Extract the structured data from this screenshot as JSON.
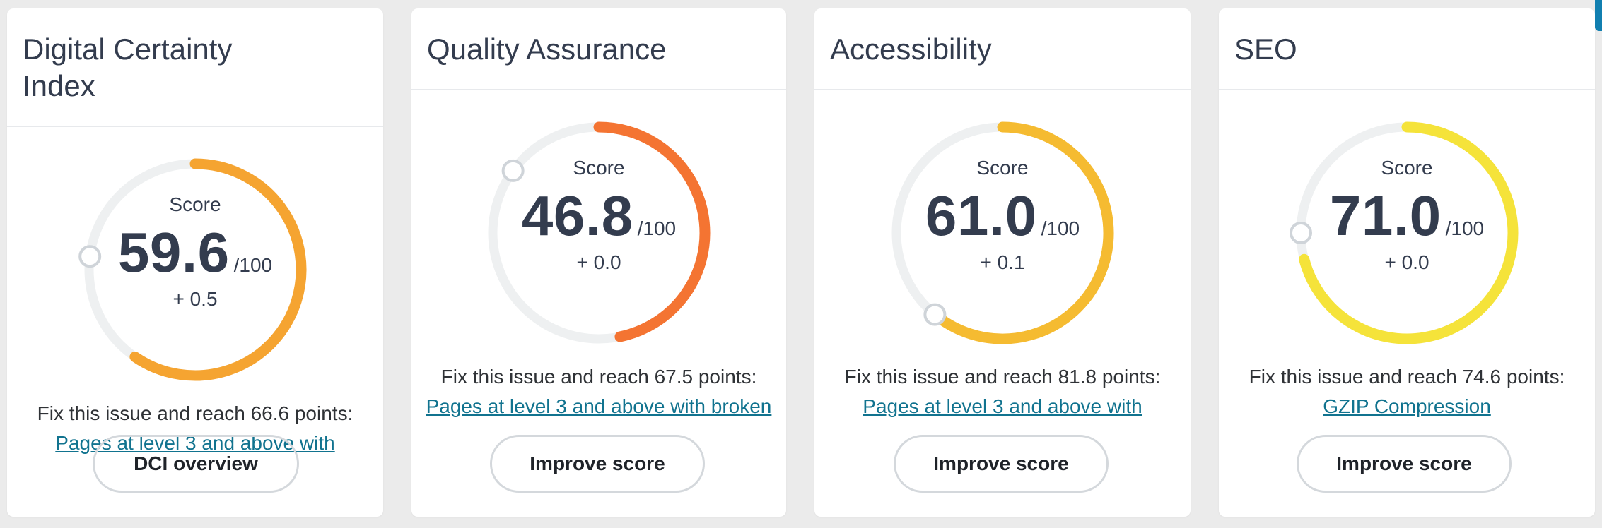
{
  "cards": [
    {
      "title": "Digital Certainty Index",
      "score_label": "Score",
      "score": "59.6",
      "score_value": 59.6,
      "max": "/100",
      "delta": "+ 0.5",
      "color": "#f5a431",
      "fix_text": "Fix this issue and reach 66.6 points:",
      "fix_link": "Pages at level 3 and above with",
      "button": "DCI overview"
    },
    {
      "title": "Quality Assurance",
      "score_label": "Score",
      "score": "46.8",
      "score_value": 46.8,
      "max": "/100",
      "delta": "+ 0.0",
      "color": "#f47432",
      "fix_text": "Fix this issue and reach 67.5 points:",
      "fix_link": "Pages at level 3 and above with broken",
      "button": "Improve score"
    },
    {
      "title": "Accessibility",
      "score_label": "Score",
      "score": "61.0",
      "score_value": 61.0,
      "max": "/100",
      "delta": "+ 0.1",
      "color": "#f5bb31",
      "fix_text": "Fix this issue and reach 81.8 points:",
      "fix_link": "Pages at level 3 and above with",
      "button": "Improve score"
    },
    {
      "title": "SEO",
      "score_label": "Score",
      "score": "71.0",
      "score_value": 71.0,
      "max": "/100",
      "delta": "+ 0.0",
      "color": "#f5e33a",
      "fix_text": "Fix this issue and reach 74.6 points:",
      "fix_link": "GZIP Compression",
      "button": "Improve score"
    }
  ],
  "colors": {
    "track": "#eef0f1",
    "handle_border": "#cfd4d9",
    "link": "#11738f",
    "edge_tab": "#117fb0"
  }
}
